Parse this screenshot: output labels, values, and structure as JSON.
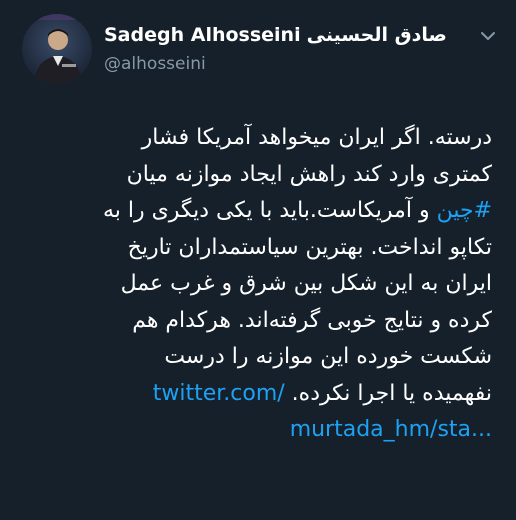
{
  "author": {
    "display_name": "Sadegh Alhosseini",
    "display_name_fa": "صادق الحسینی",
    "handle": "@alhosseini"
  },
  "tweet": {
    "line1": "درسته. اگر ایران میخواهد آمریکا فشار",
    "line2": "کمتری وارد کند راهش ایجاد موازنه میان",
    "line3_hashtag": "#چین",
    "line3_rest": " و آمریکاست.باید با یکی دیگری را به",
    "line4": "تکاپو انداخت. بهترین سیاستمداران تاریخ",
    "line5": "ایران به این شکل بین شرق و غرب عمل",
    "line6": "کرده و نتایج خوبی گرفته‌اند. هرکدام هم",
    "line7": "شکست خورده این موازنه را درست",
    "line8_text": "نفهمیده یا اجرا نکرده.",
    "line8_link": "twitter.com/",
    "line9_link": "murtada_hm/sta..."
  },
  "colors": {
    "background": "#15202b",
    "text": "#ffffff",
    "secondary": "#8899a6",
    "accent": "#1da1f2"
  },
  "icons": {
    "menu": "chevron-down-icon",
    "avatar": "avatar"
  }
}
